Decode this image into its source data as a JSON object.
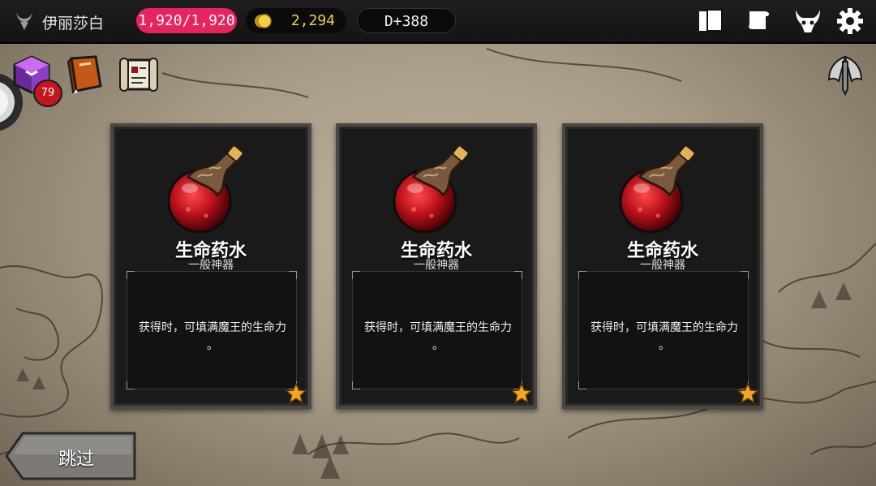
{
  "player": {
    "name": "伊丽莎白"
  },
  "stats": {
    "hp": "1,920/1,920",
    "gold": "2,294",
    "day": "D+388"
  },
  "badge_count": "79",
  "cards": [
    {
      "name": "生命药水",
      "rarity": "一般神器",
      "description": "获得时，可填满魔王的生命力",
      "description_tail": "。"
    },
    {
      "name": "生命药水",
      "rarity": "一般神器",
      "description": "获得时，可填满魔王的生命力",
      "description_tail": "。"
    },
    {
      "name": "生命药水",
      "rarity": "一般神器",
      "description": "获得时，可填满魔王的生命力",
      "description_tail": "。"
    }
  ],
  "skip_button": {
    "label": "跳过"
  },
  "colors": {
    "hp_pill": "#e8235f",
    "gold_text": "#f3cf4a",
    "card_bg": "#1b1a1a",
    "potion_red": "#b8101a"
  }
}
